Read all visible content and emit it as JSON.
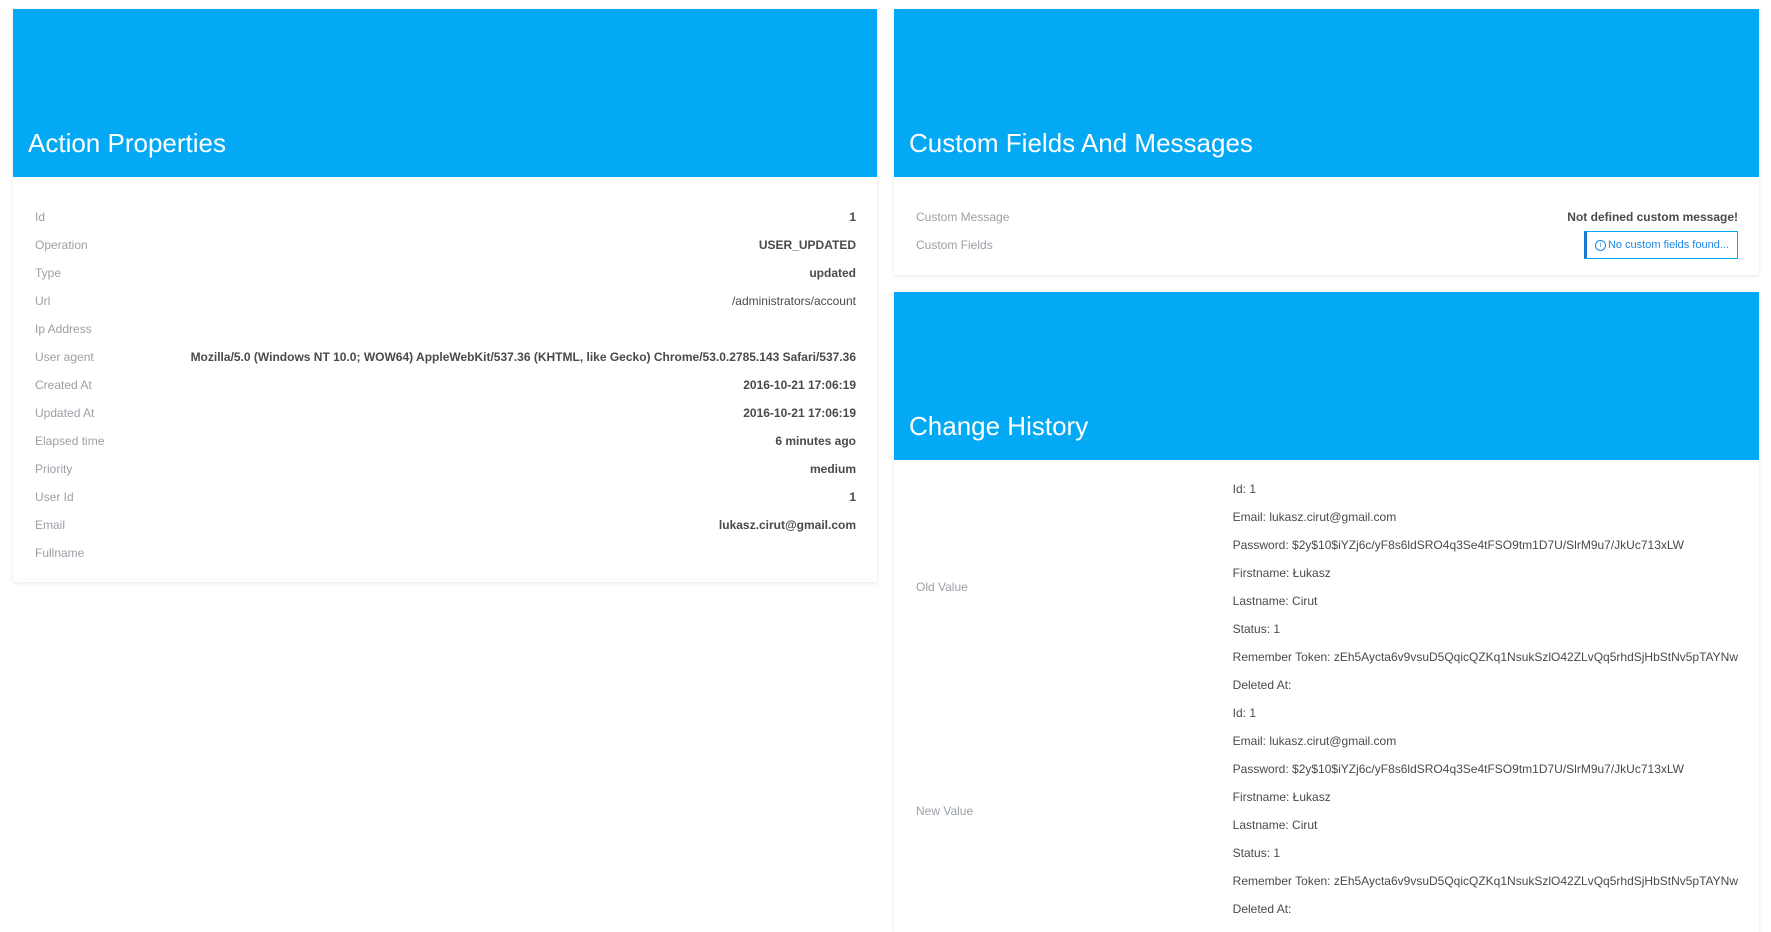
{
  "action_properties": {
    "title": "Action Properties",
    "rows": [
      {
        "label": "Id",
        "value": "1"
      },
      {
        "label": "Operation",
        "value": "USER_UPDATED"
      },
      {
        "label": "Type",
        "value": "updated"
      },
      {
        "label": "Url",
        "value": "/administrators/account"
      },
      {
        "label": "Ip Address",
        "value": ""
      },
      {
        "label": "User agent",
        "value": "Mozilla/5.0 (Windows NT 10.0; WOW64) AppleWebKit/537.36 (KHTML, like Gecko) Chrome/53.0.2785.143 Safari/537.36"
      },
      {
        "label": "Created At",
        "value": "2016-10-21 17:06:19"
      },
      {
        "label": "Updated At",
        "value": "2016-10-21 17:06:19"
      },
      {
        "label": "Elapsed time",
        "value": "6 minutes ago"
      },
      {
        "label": "Priority",
        "value": "medium"
      },
      {
        "label": "User Id",
        "value": "1"
      },
      {
        "label": "Email",
        "value": "lukasz.cirut@gmail.com"
      },
      {
        "label": "Fullname",
        "value": ""
      }
    ]
  },
  "custom_fields": {
    "title": "Custom Fields And Messages",
    "custom_message_label": "Custom Message",
    "custom_message_value": "Not defined custom message!",
    "custom_fields_label": "Custom Fields",
    "no_fields_button": "No custom fields found...",
    "no_fields_icon": "info-icon"
  },
  "change_history": {
    "title": "Change History",
    "old_label": "Old Value",
    "old_lines": [
      "Id: 1",
      "Email: lukasz.cirut@gmail.com",
      "Password: $2y$10$iYZj6c/yF8s6ldSRO4q3Se4tFSO9tm1D7U/SlrM9u7/JkUc713xLW",
      "Firstname: Łukasz",
      "Lastname: Cirut",
      "Status: 1",
      "Remember Token: zEh5Aycta6v9vsuD5QqicQZKq1NsukSzlO42ZLvQq5rhdSjHbStNv5pTAYNw",
      "Deleted At:"
    ],
    "new_label": "New Value",
    "new_lines": [
      "Id: 1",
      "Email: lukasz.cirut@gmail.com",
      "Password: $2y$10$iYZj6c/yF8s6ldSRO4q3Se4tFSO9tm1D7U/SlrM9u7/JkUc713xLW",
      "Firstname: Łukasz",
      "Lastname: Cirut",
      "Status: 1",
      "Remember Token: zEh5Aycta6v9vsuD5QqicQZKq1NsukSzlO42ZLvQq5rhdSjHbStNv5pTAYNw",
      "Deleted At:"
    ]
  },
  "colors": {
    "header": "#03a9f4",
    "label": "#9aa0a6",
    "value": "#4a4a4a",
    "button_border": "#03a9f4"
  }
}
